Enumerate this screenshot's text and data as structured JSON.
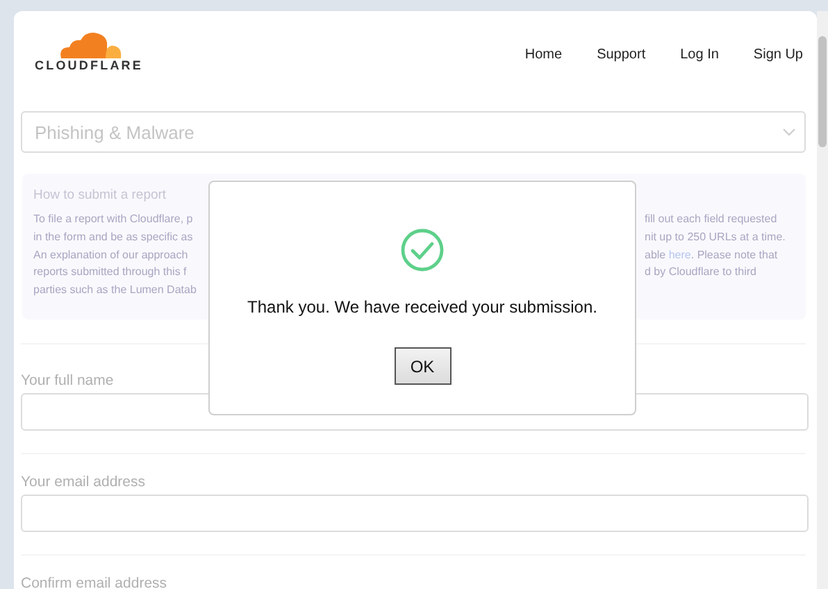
{
  "header": {
    "logo": "CLOUDFLARE",
    "nav": [
      "Home",
      "Support",
      "Log In",
      "Sign Up"
    ]
  },
  "report_type": {
    "value": "Phishing & Malware"
  },
  "info": {
    "title": "How to submit a report",
    "left_lines": [
      "To file a report with Cloudflare, p",
      "in the form and be as specific as",
      "An explanation of our approach",
      "reports submitted through this f",
      "parties such as the Lumen Datab"
    ],
    "right_lines": [
      [
        {
          "text": "fill out each field requested",
          "link": false
        }
      ],
      [
        {
          "text": "nit up to 250 URLs at a time.",
          "link": false
        }
      ],
      [
        {
          "text": "able ",
          "link": false
        },
        {
          "text": "here",
          "link": true
        },
        {
          "text": ". Please note that",
          "link": false
        }
      ],
      [
        {
          "text": "d by Cloudflare to third",
          "link": false
        }
      ]
    ]
  },
  "fields": [
    {
      "label": "Your full name"
    },
    {
      "label": "Your email address"
    },
    {
      "label": "Confirm email address"
    }
  ],
  "dialog": {
    "message": "Thank you. We have received your submission.",
    "button": "OK"
  }
}
